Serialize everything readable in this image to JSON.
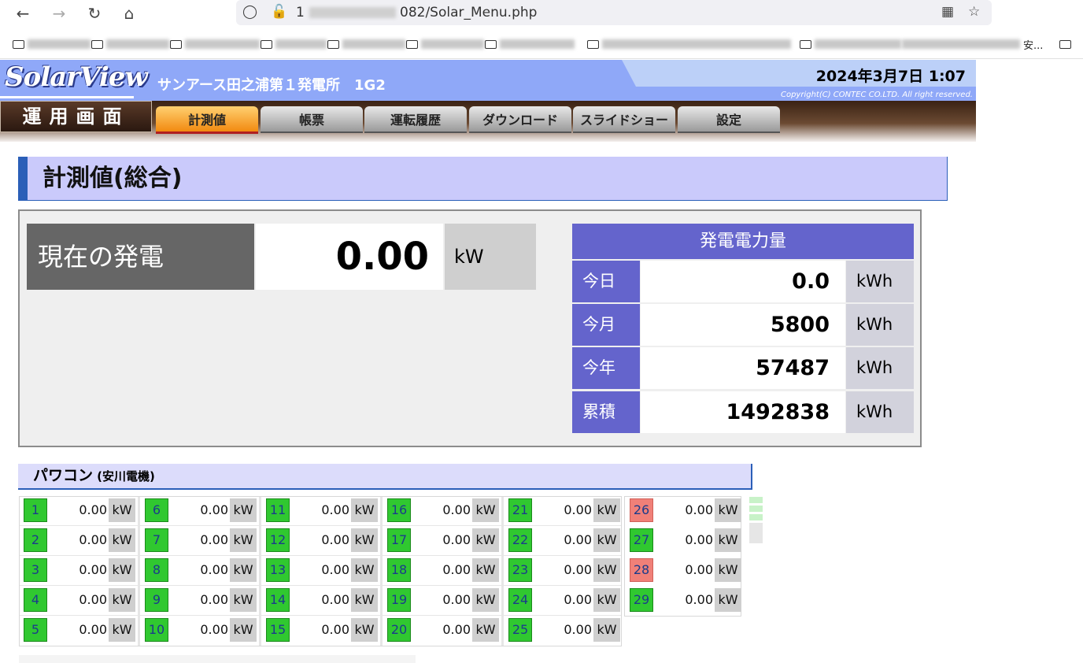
{
  "browser": {
    "url_prefix": "1",
    "url_suffix": "082/Solar_Menu.php",
    "bookmark_partial": "安..."
  },
  "app": {
    "logo": "SolarView",
    "station": "サンアース田之浦第１発電所　1G2",
    "datetime": "2024年3月7日 1:07",
    "copyright": "Copyright(C) CONTEC CO.LTD. All right reserved.",
    "menu_label": "運用画面"
  },
  "tabs": [
    {
      "label": "計測値",
      "active": true
    },
    {
      "label": "帳票",
      "active": false
    },
    {
      "label": "運転履歴",
      "active": false
    },
    {
      "label": "ダウンロード",
      "active": false
    },
    {
      "label": "スライドショー",
      "active": false
    },
    {
      "label": "設定",
      "active": false
    }
  ],
  "page_title": "計測値(総合)",
  "current": {
    "label": "現在の発電",
    "value": "0.00",
    "unit": "kW"
  },
  "generation": {
    "header": "発電電力量",
    "rows": [
      {
        "label": "今日",
        "value": "0.0",
        "unit": "kWh"
      },
      {
        "label": "今月",
        "value": "5800",
        "unit": "kWh"
      },
      {
        "label": "今年",
        "value": "57487",
        "unit": "kWh"
      },
      {
        "label": "累積",
        "value": "1492838",
        "unit": "kWh"
      }
    ]
  },
  "pcs": {
    "title": "パワコン",
    "maker": "(安川電機)",
    "unit": "kW",
    "fault_color": "#f08078",
    "ok_color": "#30c830",
    "units": [
      {
        "id": "1",
        "value": "0.00",
        "status": "ok"
      },
      {
        "id": "2",
        "value": "0.00",
        "status": "ok"
      },
      {
        "id": "3",
        "value": "0.00",
        "status": "ok"
      },
      {
        "id": "4",
        "value": "0.00",
        "status": "ok"
      },
      {
        "id": "5",
        "value": "0.00",
        "status": "ok"
      },
      {
        "id": "6",
        "value": "0.00",
        "status": "ok"
      },
      {
        "id": "7",
        "value": "0.00",
        "status": "ok"
      },
      {
        "id": "8",
        "value": "0.00",
        "status": "ok"
      },
      {
        "id": "9",
        "value": "0.00",
        "status": "ok"
      },
      {
        "id": "10",
        "value": "0.00",
        "status": "ok"
      },
      {
        "id": "11",
        "value": "0.00",
        "status": "ok"
      },
      {
        "id": "12",
        "value": "0.00",
        "status": "ok"
      },
      {
        "id": "13",
        "value": "0.00",
        "status": "ok"
      },
      {
        "id": "14",
        "value": "0.00",
        "status": "ok"
      },
      {
        "id": "15",
        "value": "0.00",
        "status": "ok"
      },
      {
        "id": "16",
        "value": "0.00",
        "status": "ok"
      },
      {
        "id": "17",
        "value": "0.00",
        "status": "ok"
      },
      {
        "id": "18",
        "value": "0.00",
        "status": "ok"
      },
      {
        "id": "19",
        "value": "0.00",
        "status": "ok"
      },
      {
        "id": "20",
        "value": "0.00",
        "status": "ok"
      },
      {
        "id": "21",
        "value": "0.00",
        "status": "ok"
      },
      {
        "id": "22",
        "value": "0.00",
        "status": "ok"
      },
      {
        "id": "23",
        "value": "0.00",
        "status": "ok"
      },
      {
        "id": "24",
        "value": "0.00",
        "status": "ok"
      },
      {
        "id": "25",
        "value": "0.00",
        "status": "ok"
      },
      {
        "id": "26",
        "value": "0.00",
        "status": "fault"
      },
      {
        "id": "27",
        "value": "0.00",
        "status": "ok"
      },
      {
        "id": "28",
        "value": "0.00",
        "status": "fault"
      },
      {
        "id": "29",
        "value": "0.00",
        "status": "ok"
      }
    ]
  },
  "icons": [
    "back-icon",
    "forward-icon",
    "reload-icon",
    "home-icon",
    "shield-icon",
    "insecure-lock-icon",
    "qr-code-icon",
    "star-icon",
    "folder-icon"
  ]
}
